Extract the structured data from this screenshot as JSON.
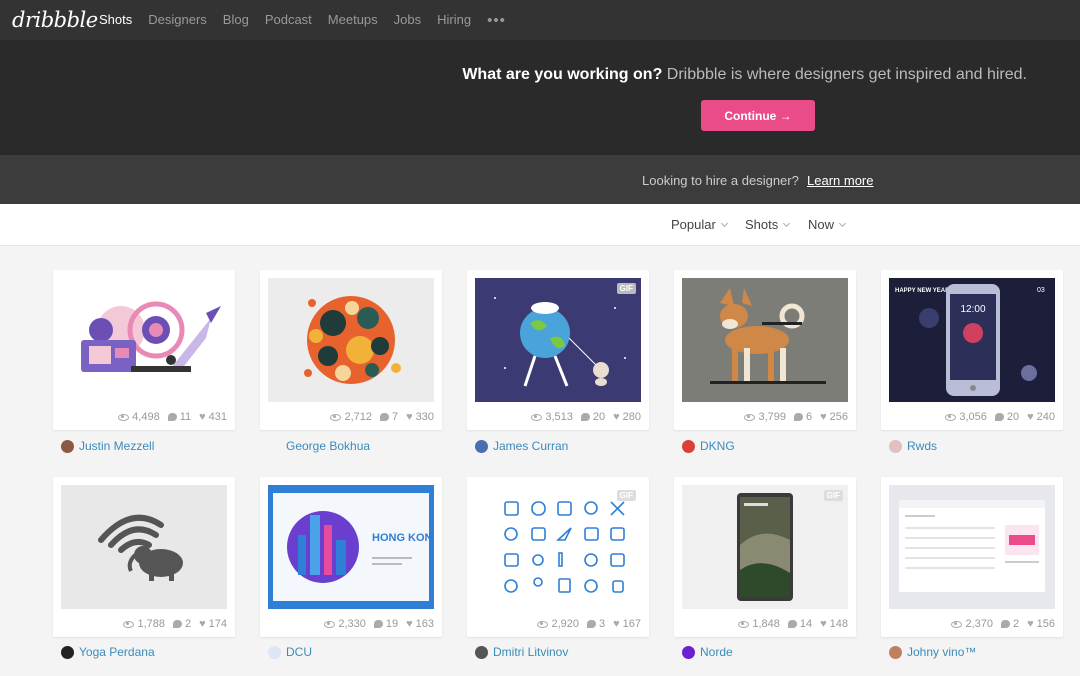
{
  "nav": {
    "logo": "dribbble",
    "items": [
      "Shots",
      "Designers",
      "Blog",
      "Podcast",
      "Meetups",
      "Jobs",
      "Hiring"
    ],
    "more": "•••"
  },
  "hero": {
    "headline": "What are you working on?",
    "tagline": " Dribbble is where designers get inspired and hired.",
    "button": "Continue →"
  },
  "hire": {
    "text": "Looking to hire a designer?",
    "link": "Learn more"
  },
  "filters": [
    "Popular",
    "Shots",
    "Now"
  ],
  "shots": [
    {
      "author": "Justin Mezzell",
      "views": "4,498",
      "comments": "11",
      "likes": "431",
      "gif": false,
      "avatar_color": "#8a5a44"
    },
    {
      "author": "George Bokhua",
      "views": "2,712",
      "comments": "7",
      "likes": "330",
      "gif": false,
      "avatar_color": ""
    },
    {
      "author": "James Curran",
      "views": "3,513",
      "comments": "20",
      "likes": "280",
      "gif": true,
      "gif_label": "GIF",
      "avatar_color": "#4a6fb0"
    },
    {
      "author": "DKNG",
      "views": "3,799",
      "comments": "6",
      "likes": "256",
      "gif": false,
      "avatar_color": "#d9403a"
    },
    {
      "author": "Rwds",
      "views": "3,056",
      "comments": "20",
      "likes": "240",
      "gif": false,
      "avatar_color": "#e0c0c0"
    },
    {
      "author": "Yoga Perdana",
      "views": "1,788",
      "comments": "2",
      "likes": "174",
      "gif": false,
      "avatar_color": "#222"
    },
    {
      "author": "DCU",
      "views": "2,330",
      "comments": "19",
      "likes": "163",
      "gif": false,
      "avatar_color": "#dce6f5"
    },
    {
      "author": "Dmitri Litvinov",
      "views": "2,920",
      "comments": "3",
      "likes": "167",
      "gif": true,
      "gif_label": "GIF",
      "avatar_color": "#555"
    },
    {
      "author": "Norde",
      "views": "1,848",
      "comments": "14",
      "likes": "148",
      "gif": true,
      "gif_label": "GIF",
      "avatar_color": "#6a1fd0"
    },
    {
      "author": "Johny vino™",
      "views": "2,370",
      "comments": "2",
      "likes": "156",
      "gif": false,
      "avatar_color": "#c08060"
    }
  ],
  "thumb_text": {
    "rwds_title": "HAPPY NEW YEAR",
    "rwds_num": "03",
    "rwds_time": "12:00",
    "dcu_title": "HONG KONG"
  },
  "colors": {
    "accent": "#ea4c89",
    "link": "#3a8bbb"
  }
}
